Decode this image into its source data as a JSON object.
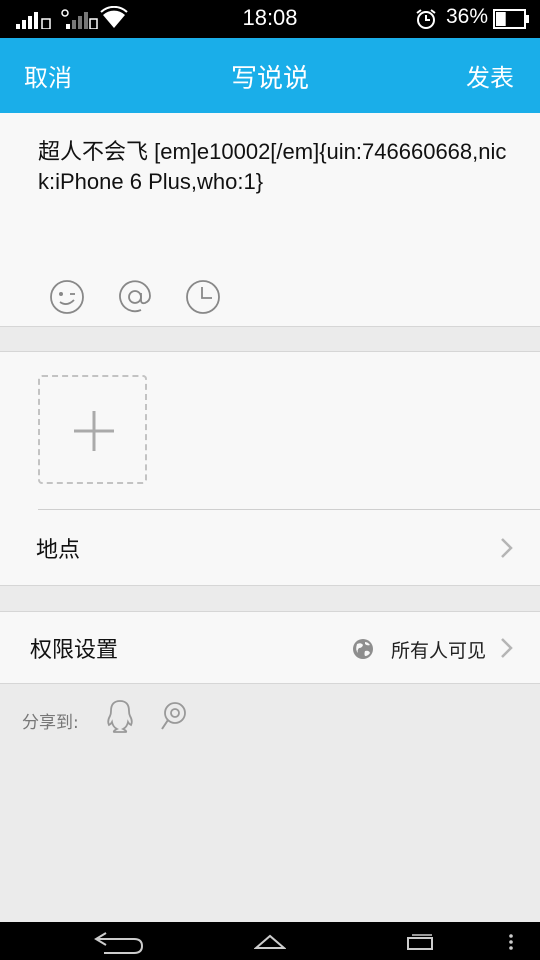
{
  "status_bar": {
    "time": "18:08",
    "battery_percent": "36%",
    "battery_level": 0.36,
    "icons": [
      "signal-icon",
      "signal-2-icon",
      "wifi-icon",
      "alarm-icon",
      "battery-icon"
    ]
  },
  "header": {
    "cancel_label": "取消",
    "title": "写说说",
    "publish_label": "发表",
    "color": "#1aaee9"
  },
  "compose": {
    "text": "超人不会飞 [em]e10002[/em]{uin:746660668,nick:iPhone 6 Plus,who:1}",
    "tools": [
      "emoji-icon",
      "at-icon",
      "clock-icon"
    ]
  },
  "media": {
    "add_icon": "plus-icon"
  },
  "location": {
    "label": "地点"
  },
  "permissions": {
    "label": "权限设置",
    "value": "所有人可见",
    "icon": "globe-icon"
  },
  "share": {
    "label": "分享到:",
    "targets": [
      "qq-icon",
      "weibo-icon"
    ]
  },
  "nav_bar": {
    "icons": [
      "back-icon",
      "home-icon",
      "recent-apps-icon",
      "menu-icon"
    ]
  }
}
